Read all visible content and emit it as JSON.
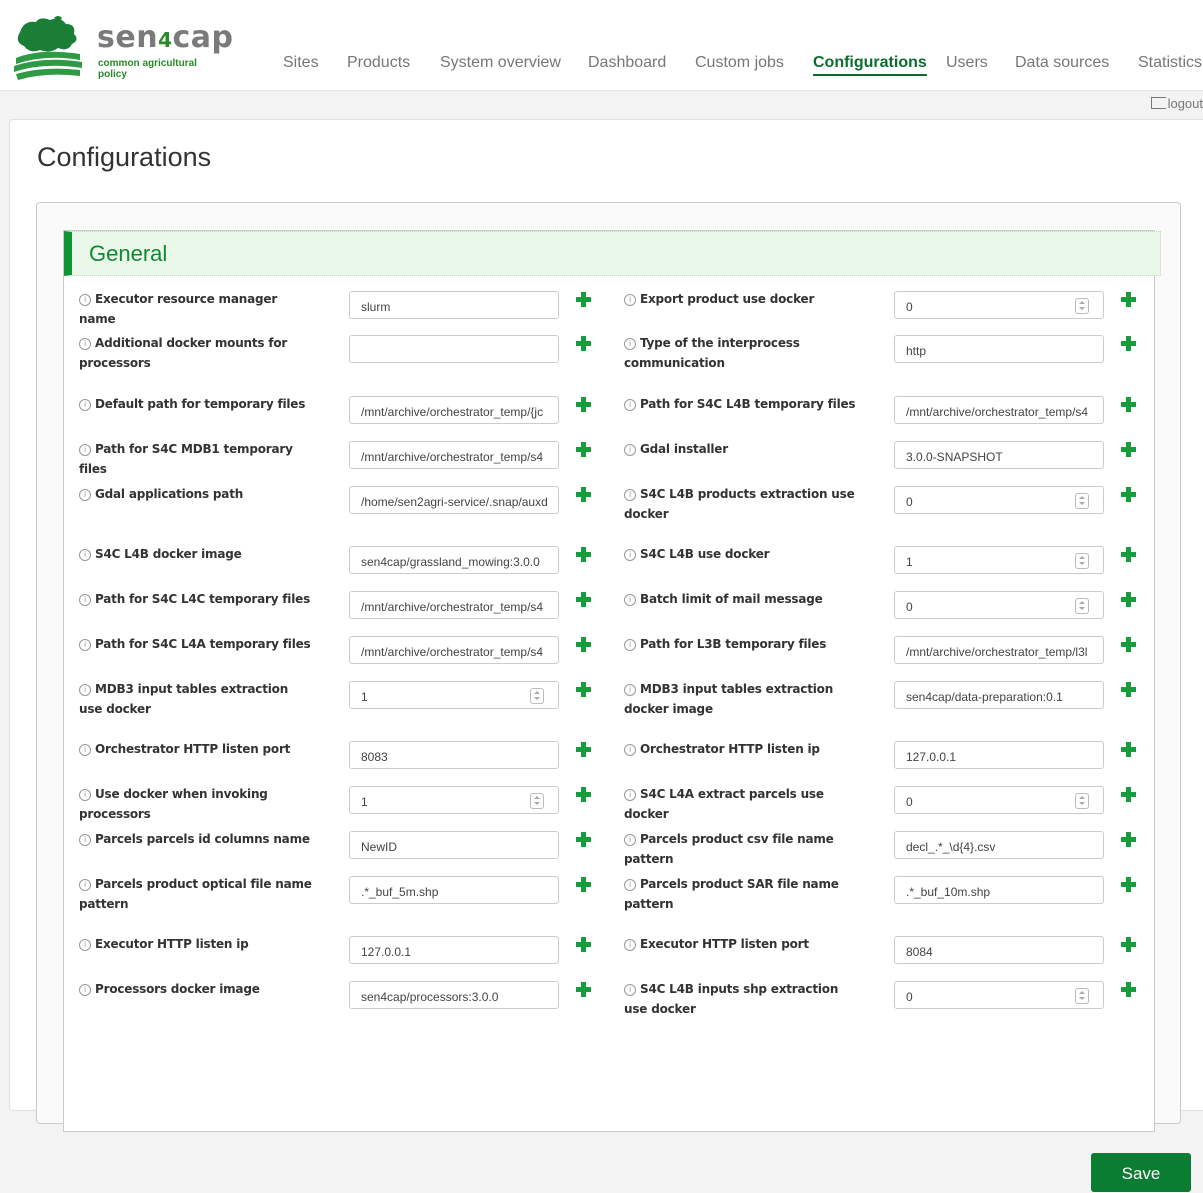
{
  "brand": {
    "name_prefix": "sen",
    "name_digit": "4",
    "name_suffix": "cap",
    "subtitle": "common agricultural policy"
  },
  "nav": [
    {
      "label": "Sites",
      "active": false
    },
    {
      "label": "Products",
      "active": false
    },
    {
      "label": "System overview",
      "active": false
    },
    {
      "label": "Dashboard",
      "active": false
    },
    {
      "label": "Custom jobs",
      "active": false
    },
    {
      "label": "Configurations",
      "active": true
    },
    {
      "label": "Users",
      "active": false
    },
    {
      "label": "Data sources",
      "active": false
    },
    {
      "label": "Statistics",
      "active": false
    }
  ],
  "logout_label": "logout",
  "page_title": "Configurations",
  "section_title": "General",
  "info_glyph": "i",
  "save_label": "Save",
  "colors": {
    "accent": "#0b7d32",
    "section_bg": "#eaf8ea",
    "add": "#169c3a"
  },
  "rows": [
    {
      "left": {
        "label": "Executor resource manager name",
        "value": "slurm",
        "numeric": false
      },
      "right": {
        "label": "Export product use docker",
        "value": "0",
        "numeric": true
      }
    },
    {
      "left": {
        "label": "Additional docker mounts for processors",
        "value": "",
        "numeric": false
      },
      "right": {
        "label": "Type of the interprocess communication",
        "value": "http",
        "numeric": false
      }
    },
    {
      "left": {
        "label": "Default path for temporary files",
        "value": "/mnt/archive/orchestrator_temp/{jc",
        "numeric": false
      },
      "right": {
        "label": "Path for S4C L4B temporary files",
        "value": "/mnt/archive/orchestrator_temp/s4",
        "numeric": false
      }
    },
    {
      "left": {
        "label": "Path for S4C MDB1 temporary files",
        "value": "/mnt/archive/orchestrator_temp/s4",
        "numeric": false
      },
      "right": {
        "label": "Gdal installer",
        "value": "3.0.0-SNAPSHOT",
        "numeric": false
      }
    },
    {
      "left": {
        "label": "Gdal applications path",
        "value": "/home/sen2agri-service/.snap/auxd",
        "numeric": false
      },
      "right": {
        "label": "S4C L4B products extraction use docker",
        "value": "0",
        "numeric": true
      }
    },
    {
      "left": {
        "label": "S4C L4B docker image",
        "value": "sen4cap/grassland_mowing:3.0.0",
        "numeric": false
      },
      "right": {
        "label": "S4C L4B use docker",
        "value": "1",
        "numeric": true
      }
    },
    {
      "left": {
        "label": "Path for S4C L4C temporary files",
        "value": "/mnt/archive/orchestrator_temp/s4",
        "numeric": false
      },
      "right": {
        "label": "Batch limit of mail message",
        "value": "0",
        "numeric": true
      }
    },
    {
      "left": {
        "label": "Path for S4C L4A temporary files",
        "value": "/mnt/archive/orchestrator_temp/s4",
        "numeric": false
      },
      "right": {
        "label": "Path for L3B temporary files",
        "value": "/mnt/archive/orchestrator_temp/l3l",
        "numeric": false
      }
    },
    {
      "left": {
        "label": "MDB3 input tables extraction use docker",
        "value": "1",
        "numeric": true
      },
      "right": {
        "label": "MDB3 input tables extraction docker image",
        "value": "sen4cap/data-preparation:0.1",
        "numeric": false
      }
    },
    {
      "left": {
        "label": "Orchestrator HTTP listen port",
        "value": "8083",
        "numeric": false
      },
      "right": {
        "label": "Orchestrator HTTP listen ip",
        "value": "127.0.0.1",
        "numeric": false
      }
    },
    {
      "left": {
        "label": "Use docker when invoking processors",
        "value": "1",
        "numeric": true
      },
      "right": {
        "label": "S4C L4A extract parcels use docker",
        "value": "0",
        "numeric": true
      }
    },
    {
      "left": {
        "label": "Parcels parcels id columns name",
        "value": "NewID",
        "numeric": false
      },
      "right": {
        "label": "Parcels product csv file name pattern",
        "value": "decl_.*_\\d{4}.csv",
        "numeric": false
      }
    },
    {
      "left": {
        "label": "Parcels product optical file name pattern",
        "value": ".*_buf_5m.shp",
        "numeric": false
      },
      "right": {
        "label": "Parcels product SAR file name pattern",
        "value": ".*_buf_10m.shp",
        "numeric": false
      }
    },
    {
      "left": {
        "label": "Executor HTTP listen ip",
        "value": "127.0.0.1",
        "numeric": false
      },
      "right": {
        "label": "Executor HTTP listen port",
        "value": "8084",
        "numeric": false
      }
    },
    {
      "left": {
        "label": "Processors docker image",
        "value": "sen4cap/processors:3.0.0",
        "numeric": false
      },
      "right": {
        "label": "S4C L4B inputs shp extraction use docker",
        "value": "0",
        "numeric": true
      }
    }
  ]
}
